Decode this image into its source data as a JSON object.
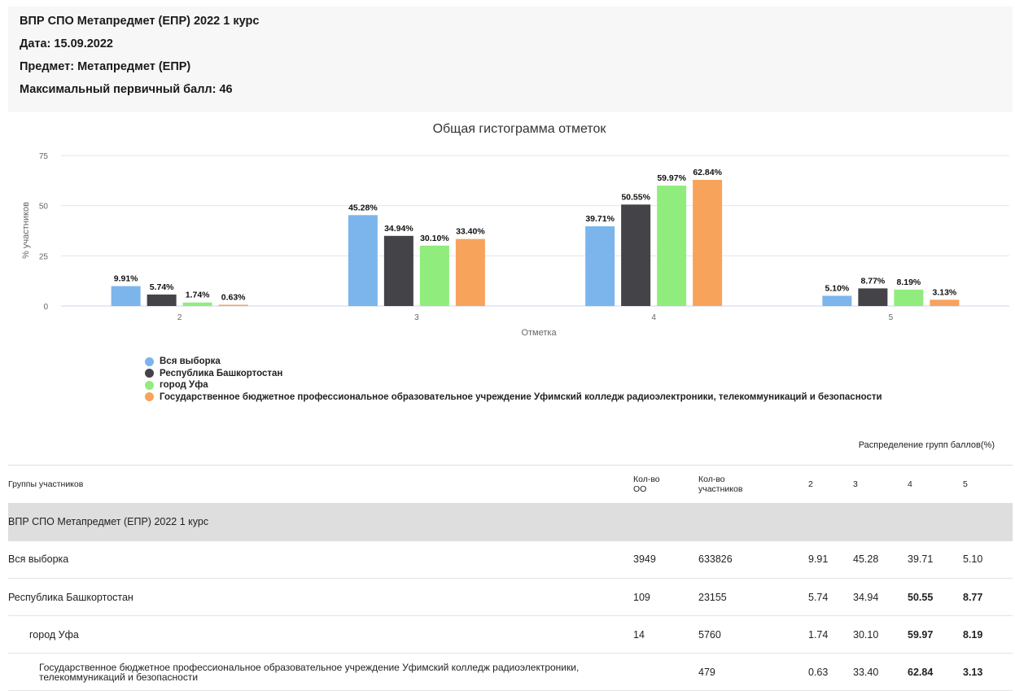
{
  "header": {
    "line1": "ВПР СПО Метапредмет (ЕПР) 2022 1 курс",
    "line2": "Дата: 15.09.2022",
    "line3": "Предмет: Метапредмет (ЕПР)",
    "line4": "Максимальный первичный балл: 46"
  },
  "chart_data": {
    "type": "bar",
    "title": "Общая гистограмма отметок",
    "xlabel": "Отметка",
    "ylabel": "% участников",
    "ylim": [
      0,
      75
    ],
    "yticks": [
      0,
      25,
      50,
      75
    ],
    "grid": true,
    "categories": [
      "2",
      "3",
      "4",
      "5"
    ],
    "series": [
      {
        "name": "Вся выборка",
        "color": "#7cb5ec",
        "values": [
          9.91,
          45.28,
          39.71,
          5.1
        ],
        "labels": [
          "9.91%",
          "45.28%",
          "39.71%",
          "5.10%"
        ]
      },
      {
        "name": "Республика Башкортостан",
        "color": "#434348",
        "values": [
          5.74,
          34.94,
          50.55,
          8.77
        ],
        "labels": [
          "5.74%",
          "34.94%",
          "50.55%",
          "8.77%"
        ]
      },
      {
        "name": "город Уфа",
        "color": "#90ed7d",
        "values": [
          1.74,
          30.1,
          59.97,
          8.19
        ],
        "labels": [
          "1.74%",
          "30.10%",
          "59.97%",
          "8.19%"
        ]
      },
      {
        "name": "Государственное бюджетное профессиональное образовательное учреждение Уфимский колледж радиоэлектроники, телекоммуникаций и безопасности",
        "color": "#f7a35c",
        "values": [
          0.63,
          33.4,
          62.84,
          3.13
        ],
        "labels": [
          "0.63%",
          "33.40%",
          "62.84%",
          "3.13%"
        ]
      }
    ],
    "legend_placement": "bottom-left"
  },
  "table": {
    "caption": "Распределение групп баллов(%)",
    "headers": {
      "group": "Группы участников",
      "oo": "Кол-во\nОО",
      "participants": "Кол-во\nучастников",
      "g2": "2",
      "g3": "3",
      "g4": "4",
      "g5": "5"
    },
    "group_title": "ВПР СПО Метапредмет (ЕПР) 2022 1 курс",
    "rows": [
      {
        "name": "Вся выборка",
        "oo": "3949",
        "participants": "633826",
        "g2": "9.91",
        "g3": "45.28",
        "g4": "39.71",
        "g5": "5.10"
      },
      {
        "name": "Республика Башкортостан",
        "oo": "109",
        "participants": "23155",
        "g2": "5.74",
        "g3": "34.94",
        "g4": "50.55",
        "g5": "8.77"
      },
      {
        "name": "город Уфа",
        "oo": "14",
        "participants": "5760",
        "g2": "1.74",
        "g3": "30.10",
        "g4": "59.97",
        "g5": "8.19"
      },
      {
        "name": "Государственное бюджетное профессиональное образовательное учреждение Уфимский колледж радиоэлектроники, телекоммуникаций и безопасности",
        "oo": "",
        "participants": "479",
        "g2": "0.63",
        "g3": "33.40",
        "g4": "62.84",
        "g5": "3.13"
      }
    ]
  }
}
